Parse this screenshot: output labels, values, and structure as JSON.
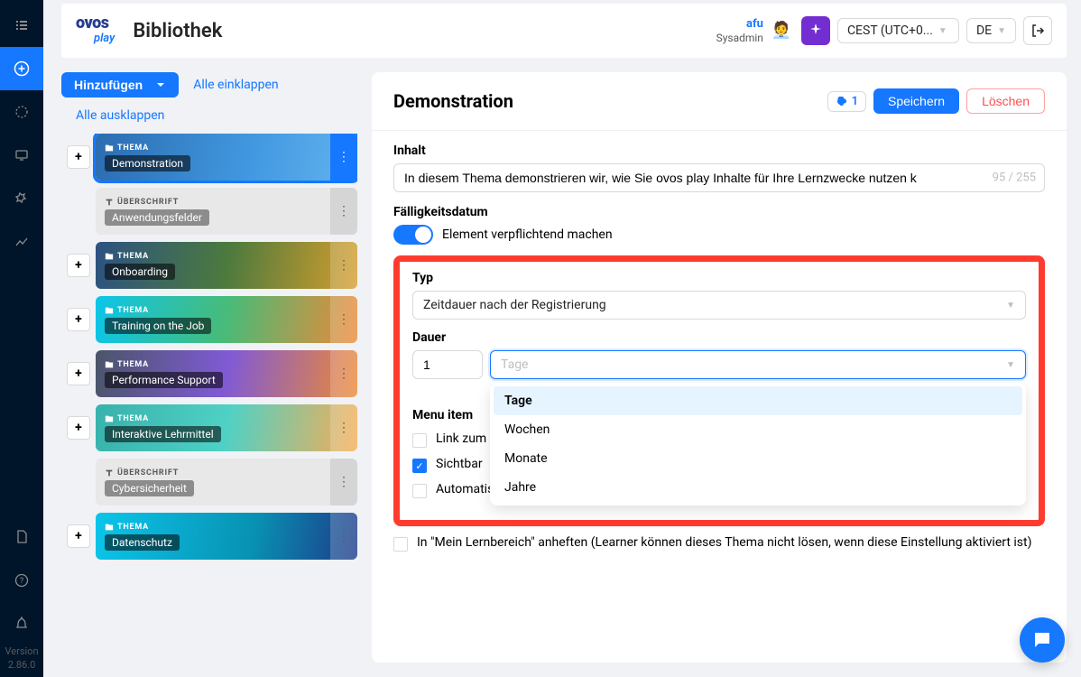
{
  "header": {
    "logo_top": "ovos",
    "logo_bottom": "play",
    "title": "Bibliothek",
    "user_name": "afu",
    "user_role": "Sysadmin",
    "timezone": "CEST (UTC+0...",
    "language": "DE"
  },
  "version": {
    "label": "Version",
    "value": "2.86.0"
  },
  "left": {
    "add_btn": "Hinzufügen",
    "collapse_all": "Alle einklappen",
    "expand_all": "Alle ausklappen",
    "theme_tag": "THEMA",
    "heading_tag": "ÜBERSCHRIFT",
    "items": [
      {
        "type": "theme",
        "title": "Demonstration",
        "bg": "bg-demo",
        "active": true,
        "add": true
      },
      {
        "type": "heading",
        "title": "Anwendungsfelder"
      },
      {
        "type": "theme",
        "title": "Onboarding",
        "bg": "bg-onboard",
        "add": true
      },
      {
        "type": "theme",
        "title": "Training on the Job",
        "bg": "bg-training",
        "add": true
      },
      {
        "type": "theme",
        "title": "Performance Support",
        "bg": "bg-perf",
        "add": true
      },
      {
        "type": "theme",
        "title": "Interaktive Lehrmittel",
        "bg": "bg-inter",
        "add": true
      },
      {
        "type": "heading",
        "title": "Cybersicherheit"
      },
      {
        "type": "theme",
        "title": "Datenschutz",
        "bg": "bg-daten",
        "add": true
      }
    ]
  },
  "panel": {
    "title": "Demonstration",
    "brain_count": "1",
    "save": "Speichern",
    "delete": "Löschen",
    "inhalt_label": "Inhalt",
    "inhalt_value": "In diesem Thema demonstrieren wir, wie Sie ovos play Inhalte für Ihre Lernzwecke nutzen k",
    "inhalt_count": "95 / 255",
    "due_label": "Fälligkeitsdatum",
    "mandatory_label": "Element verpflichtend machen",
    "typ_label": "Typ",
    "typ_value": "Zeitdauer nach der Registrierung",
    "dauer_label": "Dauer",
    "dauer_value": "1",
    "dauer_placeholder": "Tage",
    "dauer_options": [
      "Tage",
      "Wochen",
      "Monate",
      "Jahre"
    ],
    "menu_item_label": "Menu item",
    "check_link": "Link zum H",
    "check_visible": "Sichtbar",
    "check_email": "Automatisierte E-Mail, wenn abgeschlossen",
    "check_pin": "In \"Mein Lernbereich\" anheften (Learner können dieses Thema nicht lösen, wenn diese Einstellung aktiviert ist)"
  }
}
